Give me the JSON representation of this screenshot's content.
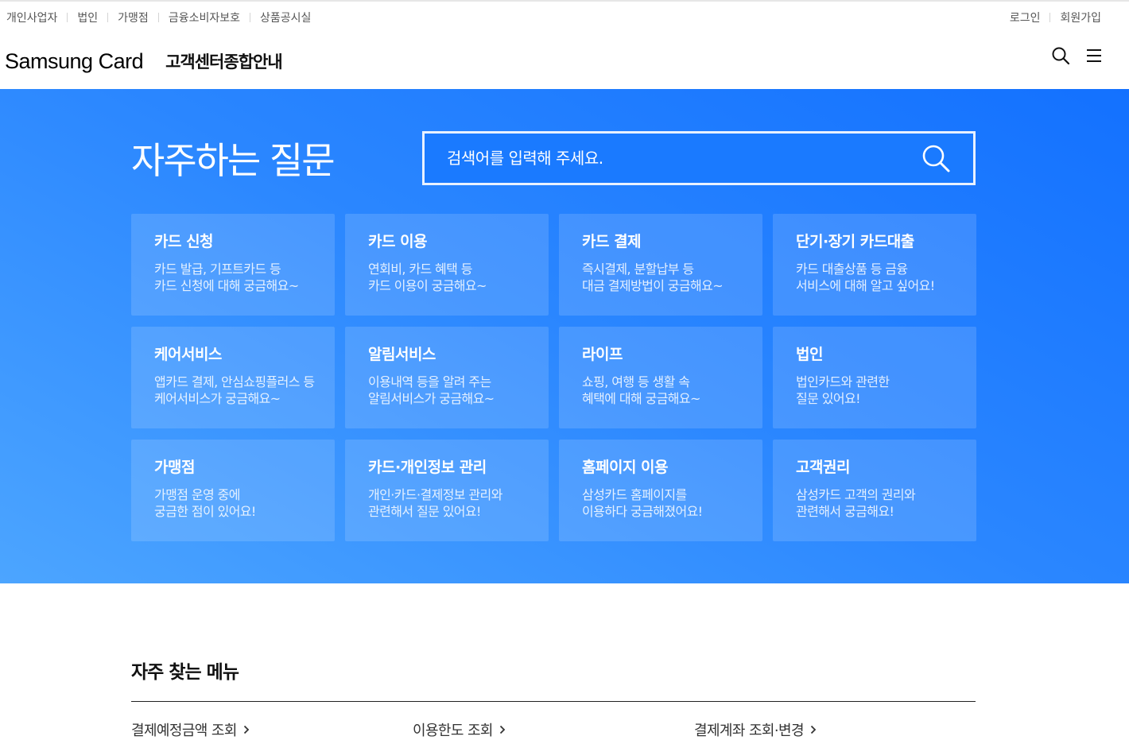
{
  "top_links": [
    "개인사업자",
    "법인",
    "가맹점",
    "금융소비자보호",
    "상품공시실"
  ],
  "user_links": [
    "로그인",
    "회원가입"
  ],
  "logo": "Samsung Card",
  "service_title": "고객센터종합안내",
  "hero": {
    "title": "자주하는 질문",
    "search_placeholder": "검색어를 입력해 주세요."
  },
  "categories": [
    {
      "title": "카드 신청",
      "line1": "카드 발급, 기프트카드 등",
      "line2": "카드 신청에 대해 궁금해요~"
    },
    {
      "title": "카드 이용",
      "line1": "연회비, 카드 혜택 등",
      "line2": "카드 이용이 궁금해요~"
    },
    {
      "title": "카드 결제",
      "line1": "즉시결제, 분할납부 등",
      "line2": "대금 결제방법이 궁금해요~"
    },
    {
      "title": "단기·장기 카드대출",
      "line1": "카드 대출상품 등 금융",
      "line2": "서비스에 대해 알고 싶어요!"
    },
    {
      "title": "케어서비스",
      "line1": "앱카드 결제, 안심쇼핑플러스 등",
      "line2": "케어서비스가 궁금해요~"
    },
    {
      "title": "알림서비스",
      "line1": "이용내역 등을 알려 주는",
      "line2": "알림서비스가 궁금해요~"
    },
    {
      "title": "라이프",
      "line1": "쇼핑, 여행 등 생활 속",
      "line2": "혜택에 대해 궁금해요~"
    },
    {
      "title": "법인",
      "line1": "법인카드와 관련한",
      "line2": "질문 있어요!"
    },
    {
      "title": "가맹점",
      "line1": "가맹점 운영 중에",
      "line2": "궁금한 점이 있어요!"
    },
    {
      "title": "카드·개인정보 관리",
      "line1": "개인·카드·결제정보 관리와",
      "line2": "관련해서 질문 있어요!"
    },
    {
      "title": "홈페이지 이용",
      "line1": "삼성카드 홈페이지를",
      "line2": "이용하다 궁금해졌어요!"
    },
    {
      "title": "고객권리",
      "line1": "삼성카드 고객의 권리와",
      "line2": "관련해서 궁금해요!"
    }
  ],
  "frequent_menu": {
    "title": "자주 찾는 메뉴",
    "items": [
      "결제예정금액 조회",
      "이용한도 조회",
      "결제계좌 조회·변경"
    ]
  },
  "colors": {
    "hero_start": "#1371ff",
    "hero_end": "#4ca5ff"
  },
  "icons": {
    "search": "search-icon",
    "menu": "hamburger-menu-icon",
    "chevron": "chevron-right-icon"
  }
}
